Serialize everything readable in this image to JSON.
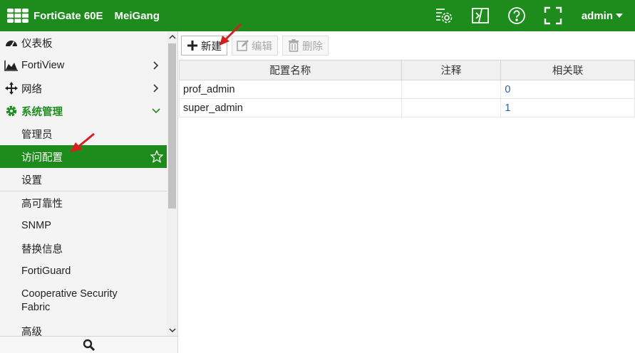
{
  "header": {
    "brand": "FortiGate 60E",
    "hostname": "MeiGang",
    "user": "admin",
    "icons": [
      "config-settings-icon",
      "cli-console-icon",
      "help-icon",
      "fullscreen-icon"
    ]
  },
  "sidebar": {
    "items": [
      {
        "label": "仪表板",
        "icon": "dashboard-icon"
      },
      {
        "label": "FortiView",
        "icon": "fortiview-chart-icon"
      },
      {
        "label": "网络",
        "icon": "network-move-icon"
      },
      {
        "label": "系统管理",
        "icon": "gear-icon"
      }
    ],
    "system_sub": [
      {
        "label": "管理员"
      },
      {
        "label": "访问配置"
      },
      {
        "label": "设置"
      }
    ],
    "more": [
      {
        "label": "高可靠性"
      },
      {
        "label": "SNMP"
      },
      {
        "label": "替换信息"
      },
      {
        "label": "FortiGuard"
      },
      {
        "label": "Cooperative Security Fabric"
      },
      {
        "label": "高级"
      }
    ]
  },
  "toolbar": {
    "new_label": "新建",
    "edit_label": "编辑",
    "delete_label": "删除"
  },
  "table": {
    "columns": [
      "配置名称",
      "注释",
      "相关联"
    ],
    "rows": [
      {
        "name": "prof_admin",
        "comment": "",
        "ref": "0"
      },
      {
        "name": "super_admin",
        "comment": "",
        "ref": "1"
      }
    ]
  },
  "colors": {
    "accent": "#1d8c1d",
    "arrow": "#d42020"
  }
}
